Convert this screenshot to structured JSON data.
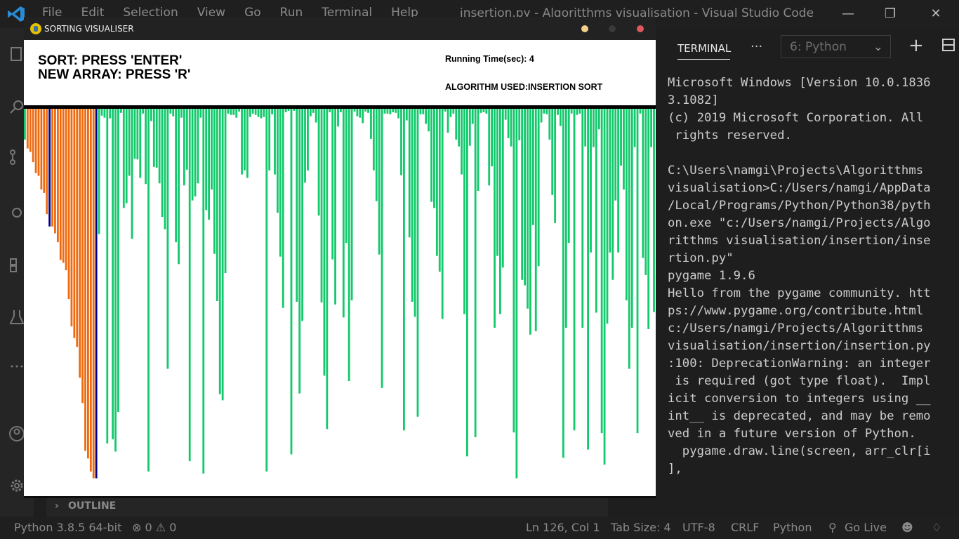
{
  "vscode": {
    "menu": [
      "File",
      "Edit",
      "Selection",
      "View",
      "Go",
      "Run",
      "Terminal",
      "Help"
    ],
    "window_title": "insertion.py - Algoritthms visualisation - Visual Studio Code",
    "outline_label": "OUTLINE",
    "terminal_tab": "TERMINAL",
    "terminal_select": "6: Python",
    "terminal_text": "Microsoft Windows [Version 10.0.1836\n3.1082]\n(c) 2019 Microsoft Corporation. All\n rights reserved.\n\nC:\\Users\\namgi\\Projects\\Algoritthms\nvisualisation>C:/Users/namgi/AppData\n/Local/Programs/Python/Python38/pyth\non.exe \"c:/Users/namgi/Projects/Algo\nritthms visualisation/insertion/inse\nrtion.py\"\npygame 1.9.6\nHello from the pygame community. htt\nps://www.pygame.org/contribute.html\nc:/Users/namgi/Projects/Algoritthms\nvisualisation/insertion/insertion.py\n:100: DeprecationWarning: an integer\n is required (got type float).  Impl\nicit conversion to integers using __\nint__ is deprecated, and may be remo\nved in a future version of Python.\n  pygame.draw.line(screen, arr_clr[i\n],"
  },
  "statusbar": {
    "python": "Python 3.8.5 64-bit",
    "problems": "⊗ 0 ⚠ 0",
    "position": "Ln 126, Col 1",
    "tabsize": "Tab Size: 4",
    "encoding": "UTF-8",
    "eol": "CRLF",
    "language": "Python",
    "golive": "Go Live"
  },
  "pygame": {
    "window_title": "SORTING VISUALISER",
    "sort_hint": "SORT: PRESS 'ENTER'",
    "new_array_hint": "NEW ARRAY: PRESS 'R'",
    "running_time": "Running Time(sec): 4",
    "algorithm": "ALGORITHM USED:INSERTION SORT",
    "colors": {
      "sorted": "#ef6a0e",
      "current": "#00008b",
      "unsorted": "#12c96b",
      "background": "#ffffff"
    },
    "bar_scale_max": 560,
    "bars": [
      {
        "v": 45,
        "s": "u"
      },
      {
        "v": 58,
        "s": "s"
      },
      {
        "v": 63,
        "s": "s"
      },
      {
        "v": 78,
        "s": "s"
      },
      {
        "v": 94,
        "s": "s"
      },
      {
        "v": 98,
        "s": "s"
      },
      {
        "v": 118,
        "s": "s"
      },
      {
        "v": 123,
        "s": "s"
      },
      {
        "v": 154,
        "s": "s"
      },
      {
        "v": 172,
        "s": "c"
      },
      {
        "v": 172,
        "s": "s"
      },
      {
        "v": 182,
        "s": "s"
      },
      {
        "v": 195,
        "s": "s"
      },
      {
        "v": 221,
        "s": "s"
      },
      {
        "v": 225,
        "s": "s"
      },
      {
        "v": 236,
        "s": "s"
      },
      {
        "v": 278,
        "s": "s"
      },
      {
        "v": 318,
        "s": "s"
      },
      {
        "v": 335,
        "s": "s"
      },
      {
        "v": 348,
        "s": "s"
      },
      {
        "v": 393,
        "s": "s"
      },
      {
        "v": 430,
        "s": "s"
      },
      {
        "v": 500,
        "s": "s"
      },
      {
        "v": 511,
        "s": "s"
      },
      {
        "v": 530,
        "s": "s"
      },
      {
        "v": 540,
        "s": "s"
      },
      {
        "v": 540,
        "s": "c"
      },
      {
        "v": 183,
        "s": "u"
      },
      {
        "v": 10,
        "s": "u"
      },
      {
        "v": 13,
        "s": "u"
      },
      {
        "v": 489,
        "s": "u"
      },
      {
        "v": 14,
        "s": "u"
      },
      {
        "v": 483,
        "s": "u"
      },
      {
        "v": 501,
        "s": "u"
      },
      {
        "v": 443,
        "s": "u"
      },
      {
        "v": 6,
        "s": "u"
      },
      {
        "v": 145,
        "s": "u"
      },
      {
        "v": 138,
        "s": "u"
      },
      {
        "v": 98,
        "s": "u"
      },
      {
        "v": 190,
        "s": "u"
      },
      {
        "v": 73,
        "s": "u"
      },
      {
        "v": 74,
        "s": "u"
      },
      {
        "v": 101,
        "s": "u"
      },
      {
        "v": 7,
        "s": "u"
      },
      {
        "v": 110,
        "s": "u"
      },
      {
        "v": 530,
        "s": "u"
      },
      {
        "v": 18,
        "s": "u"
      },
      {
        "v": 85,
        "s": "u"
      },
      {
        "v": 86,
        "s": "u"
      },
      {
        "v": 109,
        "s": "u"
      },
      {
        "v": 158,
        "s": "u"
      },
      {
        "v": 176,
        "s": "u"
      },
      {
        "v": 380,
        "s": "u"
      },
      {
        "v": 7,
        "s": "u"
      },
      {
        "v": 11,
        "s": "u"
      },
      {
        "v": 195,
        "s": "u"
      },
      {
        "v": 227,
        "s": "u"
      },
      {
        "v": 13,
        "s": "u"
      },
      {
        "v": 112,
        "s": "u"
      },
      {
        "v": 89,
        "s": "u"
      },
      {
        "v": 515,
        "s": "u"
      },
      {
        "v": 134,
        "s": "u"
      },
      {
        "v": 128,
        "s": "u"
      },
      {
        "v": 109,
        "s": "u"
      },
      {
        "v": 13,
        "s": "u"
      },
      {
        "v": 533,
        "s": "u"
      },
      {
        "v": 148,
        "s": "u"
      },
      {
        "v": 162,
        "s": "u"
      },
      {
        "v": 118,
        "s": "u"
      },
      {
        "v": 212,
        "s": "u"
      },
      {
        "v": 281,
        "s": "u"
      },
      {
        "v": 417,
        "s": "u"
      },
      {
        "v": 426,
        "s": "u"
      },
      {
        "v": 240,
        "s": "u"
      },
      {
        "v": 7,
        "s": "u"
      },
      {
        "v": 9,
        "s": "u"
      },
      {
        "v": 9,
        "s": "u"
      },
      {
        "v": 13,
        "s": "u"
      },
      {
        "v": 4,
        "s": "u"
      },
      {
        "v": 96,
        "s": "u"
      },
      {
        "v": 90,
        "s": "u"
      },
      {
        "v": 101,
        "s": "u"
      },
      {
        "v": 12,
        "s": "u"
      },
      {
        "v": 7,
        "s": "u"
      },
      {
        "v": 9,
        "s": "u"
      },
      {
        "v": 12,
        "s": "u"
      },
      {
        "v": 14,
        "s": "u"
      },
      {
        "v": 12,
        "s": "u"
      },
      {
        "v": 530,
        "s": "u"
      },
      {
        "v": 90,
        "s": "u"
      },
      {
        "v": 8,
        "s": "u"
      },
      {
        "v": 96,
        "s": "u"
      },
      {
        "v": 152,
        "s": "u"
      },
      {
        "v": 216,
        "s": "u"
      },
      {
        "v": 291,
        "s": "u"
      },
      {
        "v": 5,
        "s": "u"
      },
      {
        "v": 3,
        "s": "u"
      },
      {
        "v": 505,
        "s": "u"
      },
      {
        "v": 3,
        "s": "u"
      },
      {
        "v": 282,
        "s": "u"
      },
      {
        "v": 416,
        "s": "u"
      },
      {
        "v": 310,
        "s": "u"
      },
      {
        "v": 108,
        "s": "u"
      },
      {
        "v": 90,
        "s": "u"
      },
      {
        "v": 11,
        "s": "u"
      },
      {
        "v": 6,
        "s": "u"
      },
      {
        "v": 20,
        "s": "u"
      },
      {
        "v": 156,
        "s": "u"
      },
      {
        "v": 283,
        "s": "u"
      },
      {
        "v": 390,
        "s": "u"
      },
      {
        "v": 468,
        "s": "u"
      },
      {
        "v": 5,
        "s": "u"
      },
      {
        "v": 220,
        "s": "u"
      },
      {
        "v": 286,
        "s": "u"
      },
      {
        "v": 26,
        "s": "u"
      },
      {
        "v": 5,
        "s": "u"
      },
      {
        "v": 305,
        "s": "u"
      },
      {
        "v": 196,
        "s": "u"
      },
      {
        "v": 398,
        "s": "u"
      },
      {
        "v": 280,
        "s": "u"
      },
      {
        "v": 4,
        "s": "u"
      },
      {
        "v": 11,
        "s": "u"
      },
      {
        "v": 13,
        "s": "u"
      },
      {
        "v": 21,
        "s": "u"
      },
      {
        "v": 4,
        "s": "u"
      },
      {
        "v": 6,
        "s": "u"
      },
      {
        "v": 44,
        "s": "u"
      },
      {
        "v": 90,
        "s": "u"
      },
      {
        "v": 135,
        "s": "u"
      },
      {
        "v": 213,
        "s": "u"
      },
      {
        "v": 408,
        "s": "u"
      },
      {
        "v": 7,
        "s": "u"
      },
      {
        "v": 7,
        "s": "u"
      },
      {
        "v": 8,
        "s": "u"
      },
      {
        "v": 5,
        "s": "u"
      },
      {
        "v": 6,
        "s": "u"
      },
      {
        "v": 14,
        "s": "u"
      },
      {
        "v": 97,
        "s": "u"
      },
      {
        "v": 470,
        "s": "u"
      },
      {
        "v": 17,
        "s": "u"
      },
      {
        "v": 188,
        "s": "u"
      },
      {
        "v": 282,
        "s": "u"
      },
      {
        "v": 304,
        "s": "u"
      },
      {
        "v": 450,
        "s": "u"
      },
      {
        "v": 8,
        "s": "u"
      },
      {
        "v": 8,
        "s": "u"
      },
      {
        "v": 22,
        "s": "u"
      },
      {
        "v": 33,
        "s": "u"
      },
      {
        "v": 136,
        "s": "u"
      },
      {
        "v": 145,
        "s": "u"
      },
      {
        "v": 215,
        "s": "u"
      },
      {
        "v": 238,
        "s": "u"
      },
      {
        "v": 307,
        "s": "u"
      },
      {
        "v": 4,
        "s": "u"
      },
      {
        "v": 35,
        "s": "u"
      },
      {
        "v": 12,
        "s": "u"
      },
      {
        "v": 7,
        "s": "u"
      },
      {
        "v": 45,
        "s": "u"
      },
      {
        "v": 55,
        "s": "u"
      },
      {
        "v": 96,
        "s": "u"
      },
      {
        "v": 300,
        "s": "u"
      },
      {
        "v": 508,
        "s": "u"
      },
      {
        "v": 54,
        "s": "u"
      },
      {
        "v": 22,
        "s": "u"
      },
      {
        "v": 480,
        "s": "u"
      },
      {
        "v": 120,
        "s": "u"
      },
      {
        "v": 6,
        "s": "u"
      },
      {
        "v": 5,
        "s": "u"
      },
      {
        "v": 7,
        "s": "u"
      },
      {
        "v": 112,
        "s": "u"
      },
      {
        "v": 84,
        "s": "u"
      },
      {
        "v": 320,
        "s": "u"
      },
      {
        "v": 215,
        "s": "u"
      },
      {
        "v": 300,
        "s": "u"
      },
      {
        "v": 232,
        "s": "u"
      },
      {
        "v": 16,
        "s": "u"
      },
      {
        "v": 43,
        "s": "u"
      },
      {
        "v": 55,
        "s": "u"
      },
      {
        "v": 473,
        "s": "u"
      },
      {
        "v": 540,
        "s": "u"
      },
      {
        "v": 46,
        "s": "u"
      },
      {
        "v": 250,
        "s": "u"
      },
      {
        "v": 258,
        "s": "u"
      },
      {
        "v": 292,
        "s": "u"
      },
      {
        "v": 330,
        "s": "u"
      },
      {
        "v": 170,
        "s": "u"
      },
      {
        "v": 325,
        "s": "u"
      },
      {
        "v": 230,
        "s": "u"
      },
      {
        "v": 20,
        "s": "u"
      },
      {
        "v": 7,
        "s": "u"
      },
      {
        "v": 8,
        "s": "u"
      },
      {
        "v": 45,
        "s": "u"
      },
      {
        "v": 126,
        "s": "u"
      },
      {
        "v": 167,
        "s": "u"
      },
      {
        "v": 9,
        "s": "u"
      },
      {
        "v": 25,
        "s": "u"
      },
      {
        "v": 510,
        "s": "u"
      },
      {
        "v": 320,
        "s": "u"
      },
      {
        "v": 196,
        "s": "u"
      },
      {
        "v": 7,
        "s": "u"
      },
      {
        "v": 470,
        "s": "u"
      },
      {
        "v": 9,
        "s": "u"
      },
      {
        "v": 7,
        "s": "u"
      },
      {
        "v": 320,
        "s": "u"
      },
      {
        "v": 55,
        "s": "u"
      },
      {
        "v": 498,
        "s": "u"
      },
      {
        "v": 210,
        "s": "u"
      },
      {
        "v": 56,
        "s": "u"
      },
      {
        "v": 298,
        "s": "u"
      },
      {
        "v": 30,
        "s": "u"
      },
      {
        "v": 474,
        "s": "u"
      },
      {
        "v": 520,
        "s": "u"
      },
      {
        "v": 314,
        "s": "u"
      },
      {
        "v": 210,
        "s": "u"
      },
      {
        "v": 250,
        "s": "u"
      },
      {
        "v": 134,
        "s": "u"
      },
      {
        "v": 210,
        "s": "u"
      },
      {
        "v": 83,
        "s": "u"
      },
      {
        "v": 118,
        "s": "u"
      },
      {
        "v": 280,
        "s": "u"
      },
      {
        "v": 380,
        "s": "u"
      },
      {
        "v": 320,
        "s": "u"
      },
      {
        "v": 56,
        "s": "u"
      },
      {
        "v": 474,
        "s": "u"
      },
      {
        "v": 7,
        "s": "u"
      },
      {
        "v": 218,
        "s": "u"
      },
      {
        "v": 243,
        "s": "u"
      },
      {
        "v": 322,
        "s": "u"
      },
      {
        "v": 56,
        "s": "u"
      },
      {
        "v": 297,
        "s": "u"
      }
    ]
  }
}
